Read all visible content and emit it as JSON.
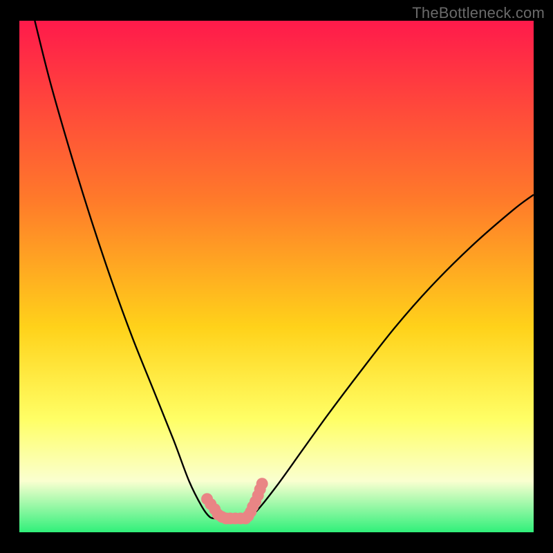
{
  "watermark": "TheBottleneck.com",
  "colors": {
    "bg_black": "#000000",
    "grad_top": "#ff1a4b",
    "grad_mid1": "#ff7a2a",
    "grad_mid2": "#ffd21a",
    "grad_mid3": "#ffff66",
    "grad_mid4": "#faffd0",
    "grad_bottom": "#30f07a",
    "curve": "#000000",
    "marker": "#e98585"
  },
  "chart_data": {
    "type": "line",
    "title": "",
    "xlabel": "",
    "ylabel": "",
    "xlim": [
      0,
      100
    ],
    "ylim": [
      0,
      100
    ],
    "series": [
      {
        "name": "left-branch",
        "x": [
          3,
          6,
          10,
          14,
          18,
          22,
          26,
          30,
          33,
          35.5,
          37,
          38
        ],
        "y": [
          100,
          88,
          74,
          61,
          49,
          38,
          28,
          18,
          10,
          5,
          3,
          2.7
        ]
      },
      {
        "name": "right-branch",
        "x": [
          44,
          46,
          50,
          55,
          60,
          66,
          73,
          80,
          88,
          96,
          100
        ],
        "y": [
          2.7,
          4,
          9,
          16,
          23,
          31,
          40,
          48,
          56,
          63,
          66
        ]
      },
      {
        "name": "valley-floor",
        "x": [
          38,
          40,
          42,
          44
        ],
        "y": [
          2.7,
          2.2,
          2.2,
          2.7
        ]
      }
    ],
    "markers": [
      {
        "name": "left-marker",
        "x": [
          36.5,
          37.2,
          38.0,
          38.6,
          39.4,
          40.2,
          41.0,
          42.0,
          43.0
        ],
        "y": [
          6.5,
          5.5,
          4.5,
          3.5,
          3.0,
          2.7,
          2.7,
          2.7,
          2.7
        ]
      },
      {
        "name": "right-marker",
        "x": [
          44.0,
          44.5,
          45.0,
          45.4,
          45.9,
          46.4,
          46.8,
          47.2
        ],
        "y": [
          2.7,
          3.2,
          4.0,
          5.0,
          6.0,
          7.2,
          8.4,
          9.5
        ]
      }
    ]
  }
}
